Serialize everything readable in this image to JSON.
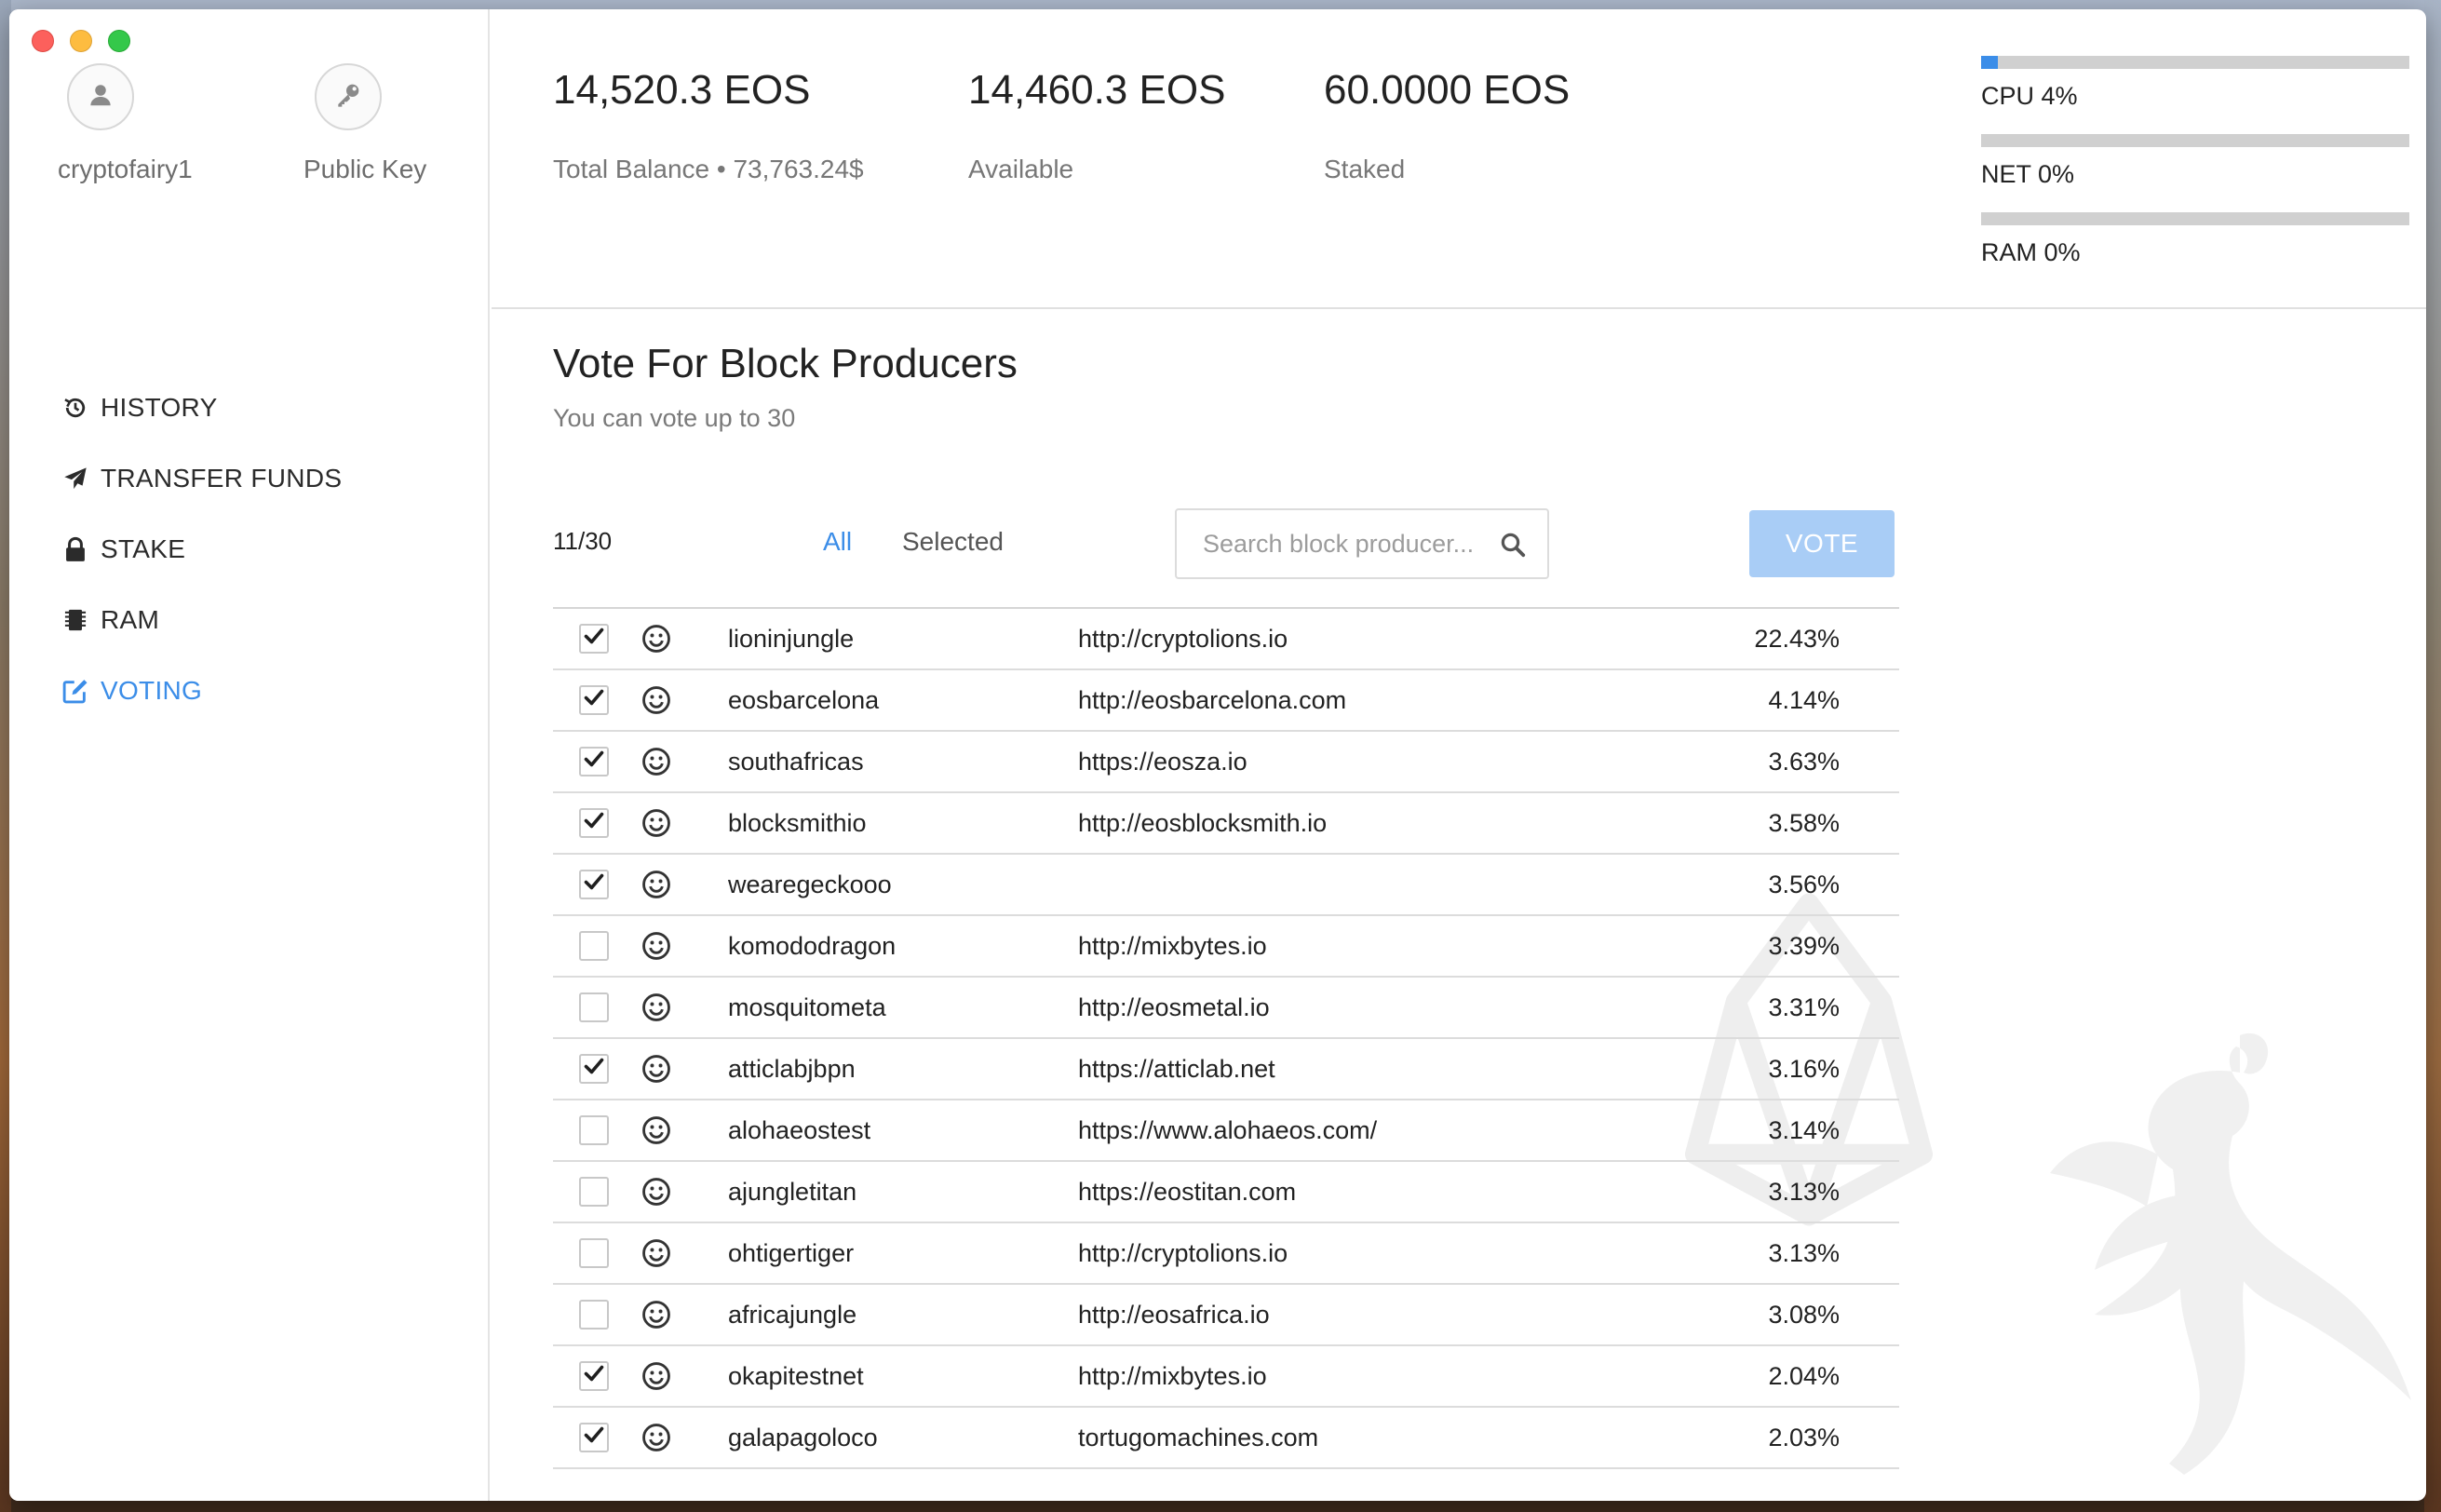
{
  "window": {
    "controls": [
      "close",
      "minimize",
      "maximize"
    ]
  },
  "sidebar": {
    "account_name": "cryptofairy1",
    "public_key_label": "Public Key",
    "nav": [
      {
        "id": "history",
        "label": "HISTORY",
        "icon": "history-icon",
        "active": false
      },
      {
        "id": "transfer",
        "label": "TRANSFER FUNDS",
        "icon": "paper-plane-icon",
        "active": false
      },
      {
        "id": "stake",
        "label": "STAKE",
        "icon": "lock-icon",
        "active": false
      },
      {
        "id": "ram",
        "label": "RAM",
        "icon": "chip-icon",
        "active": false
      },
      {
        "id": "voting",
        "label": "VOTING",
        "icon": "edit-icon",
        "active": true
      }
    ]
  },
  "balances": {
    "total_amount": "14,520.3 EOS",
    "total_caption": "Total Balance • 73,763.24$",
    "available_amount": "14,460.3 EOS",
    "available_caption": "Available",
    "staked_amount": "60.0000 EOS",
    "staked_caption": "Staked"
  },
  "resources": [
    {
      "label": "CPU 4%",
      "percent": 4
    },
    {
      "label": "NET 0%",
      "percent": 0
    },
    {
      "label": "RAM 0%",
      "percent": 0
    }
  ],
  "voting": {
    "title": "Vote For Block Producers",
    "subtitle": "You can vote up to 30",
    "count": "11/30",
    "filter_all": "All",
    "filter_selected": "Selected",
    "search_placeholder": "Search block producer...",
    "vote_button": "VOTE",
    "producers": [
      {
        "name": "lioninjungle",
        "url": "http://cryptolions.io",
        "percent": "22.43%",
        "checked": true
      },
      {
        "name": "eosbarcelona",
        "url": "http://eosbarcelona.com",
        "percent": "4.14%",
        "checked": true
      },
      {
        "name": "southafricas",
        "url": "https://eosza.io",
        "percent": "3.63%",
        "checked": true
      },
      {
        "name": "blocksmithio",
        "url": "http://eosblocksmith.io",
        "percent": "3.58%",
        "checked": true
      },
      {
        "name": "wearegeckooo",
        "url": "",
        "percent": "3.56%",
        "checked": true
      },
      {
        "name": "komododragon",
        "url": "http://mixbytes.io",
        "percent": "3.39%",
        "checked": false
      },
      {
        "name": "mosquitometa",
        "url": "http://eosmetal.io",
        "percent": "3.31%",
        "checked": false
      },
      {
        "name": "atticlabjbpn",
        "url": "https://atticlab.net",
        "percent": "3.16%",
        "checked": true
      },
      {
        "name": "alohaeostest",
        "url": "https://www.alohaeos.com/",
        "percent": "3.14%",
        "checked": false
      },
      {
        "name": "ajungletitan",
        "url": "https://eostitan.com",
        "percent": "3.13%",
        "checked": false
      },
      {
        "name": "ohtigertiger",
        "url": "http://cryptolions.io",
        "percent": "3.13%",
        "checked": false
      },
      {
        "name": "africajungle",
        "url": "http://eosafrica.io",
        "percent": "3.08%",
        "checked": false
      },
      {
        "name": "okapitestnet",
        "url": "http://mixbytes.io",
        "percent": "2.04%",
        "checked": true
      },
      {
        "name": "galapagoloco",
        "url": "tortugomachines.com",
        "percent": "2.03%",
        "checked": true
      }
    ]
  },
  "colors": {
    "accent": "#3b8de8",
    "vote_button_bg": "#a9cdf6",
    "bar_track": "#d0d0d0"
  }
}
